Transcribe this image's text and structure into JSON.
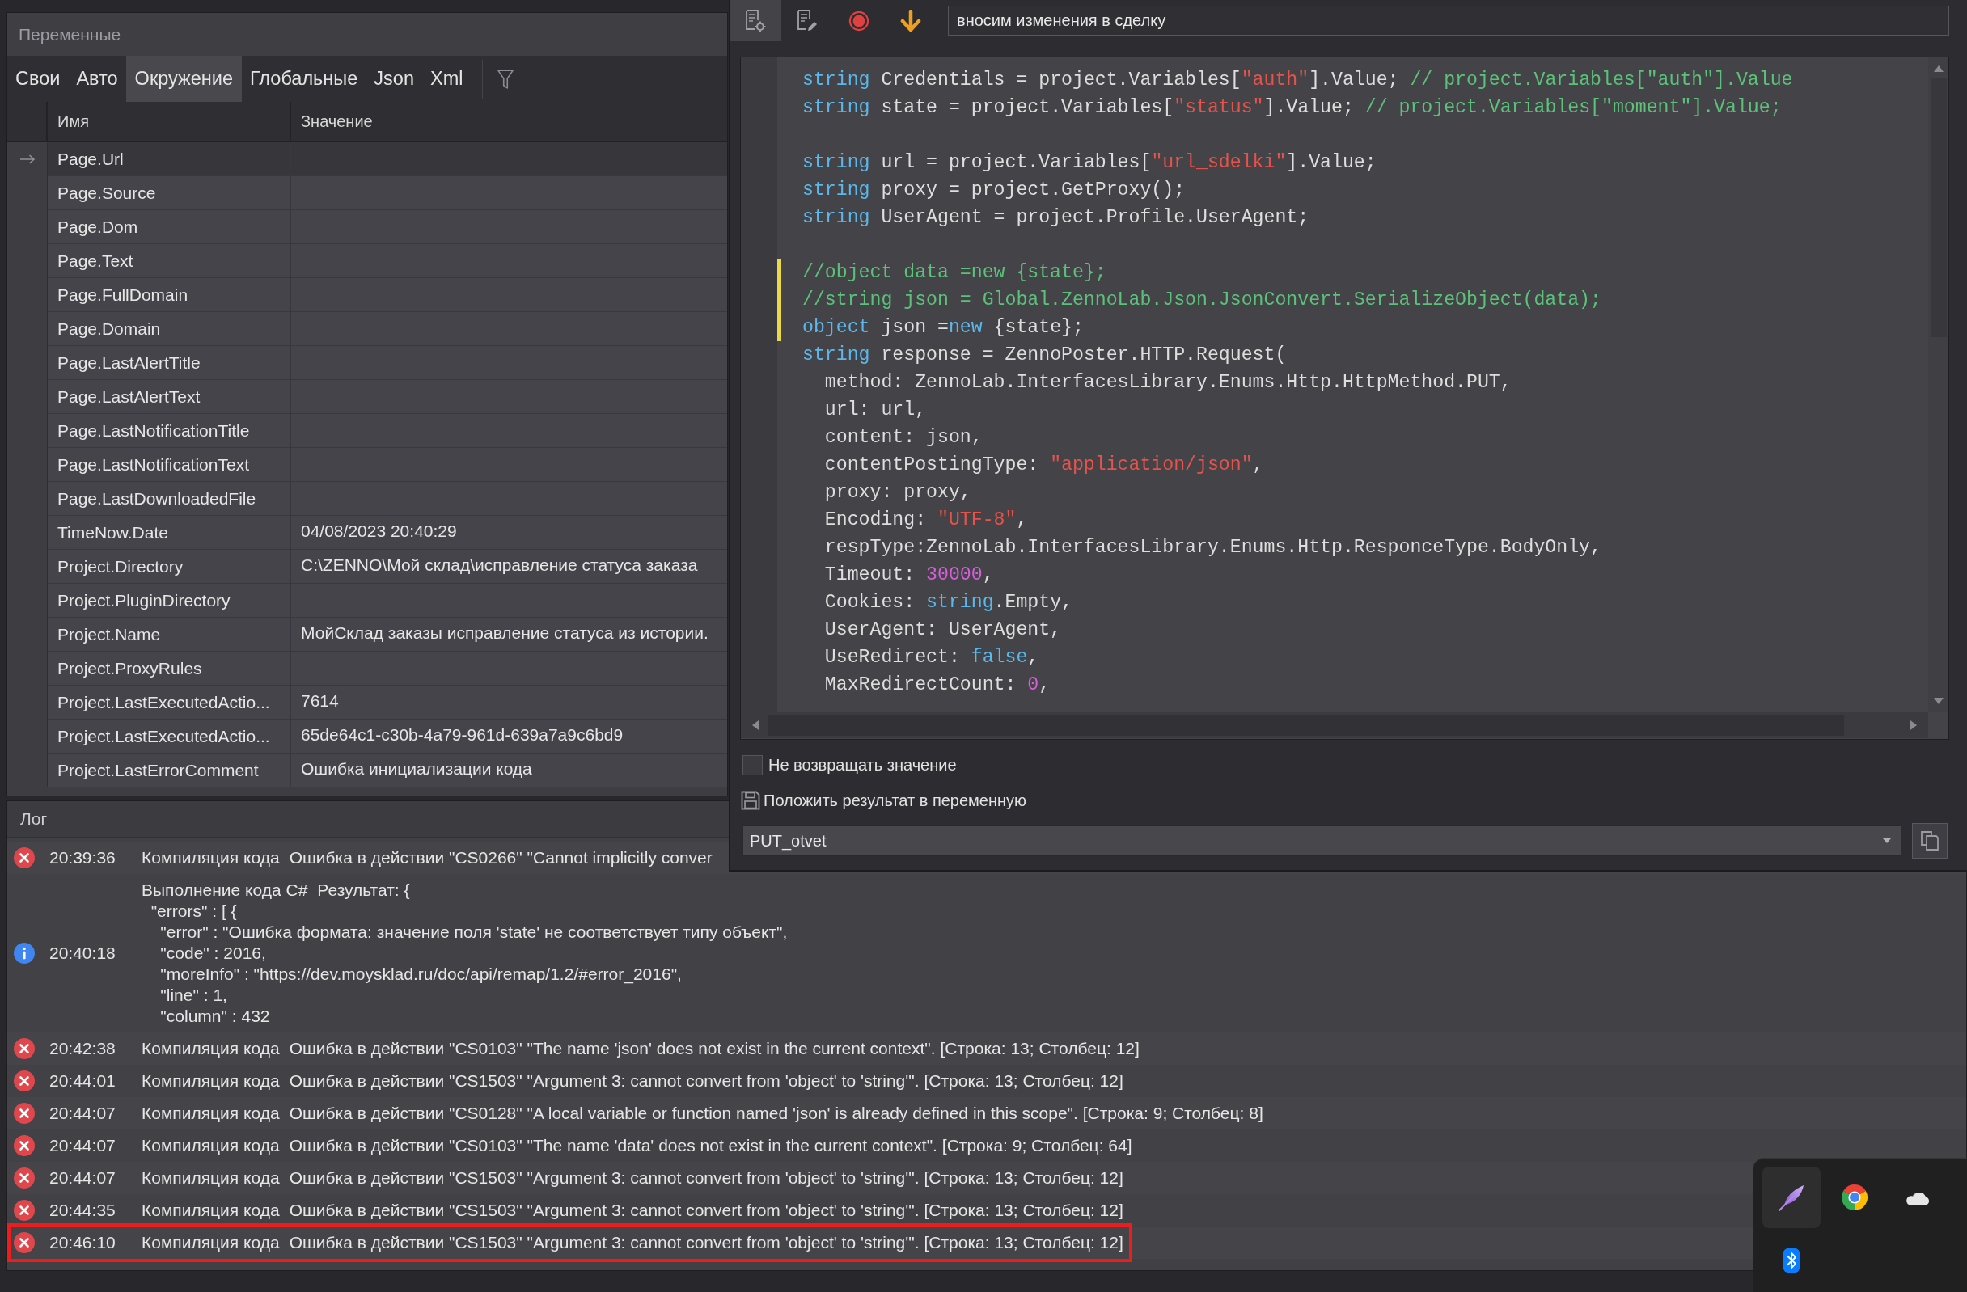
{
  "variables_panel": {
    "title": "Переменные",
    "tabs": [
      {
        "label": "Свои",
        "selected": false
      },
      {
        "label": "Авто",
        "selected": false
      },
      {
        "label": "Окружение",
        "selected": true
      },
      {
        "label": "Глобальные",
        "selected": false
      },
      {
        "label": "Json",
        "selected": false
      },
      {
        "label": "Xml",
        "selected": false
      }
    ],
    "columns": [
      "Имя",
      "Значение"
    ],
    "rows": [
      {
        "name": "Page.Url",
        "selected": true
      },
      {
        "name": "Page.Source",
        "selected": false
      },
      {
        "name": "Page.Dom",
        "selected": false
      },
      {
        "name": "Page.Text",
        "selected": false
      },
      {
        "name": "Page.FullDomain",
        "selected": false
      },
      {
        "name": "Page.Domain",
        "selected": false
      },
      {
        "name": "Page.LastAlertTitle",
        "selected": false
      },
      {
        "name": "Page.LastAlertText",
        "selected": false
      },
      {
        "name": "Page.LastNotificationTitle",
        "selected": false
      },
      {
        "name": "Page.LastNotificationText",
        "selected": false
      },
      {
        "name": "Page.LastDownloadedFile",
        "selected": false
      },
      {
        "name": "TimeNow.Date",
        "value": "04/08/2023 20:40:29",
        "selected": false
      },
      {
        "name": "Project.Directory",
        "value": "C:\\ZENNO\\Мой склад\\исправление статуса заказа",
        "selected": false
      },
      {
        "name": "Project.PluginDirectory",
        "selected": false
      },
      {
        "name": "Project.Name",
        "value": "МойСклад заказы исправление статуса из истории.",
        "selected": false
      },
      {
        "name": "Project.ProxyRules",
        "selected": false
      },
      {
        "name": "Project.LastExecutedActio...",
        "value": "7614",
        "selected": false
      },
      {
        "name": "Project.LastExecutedActio...",
        "value": "65de64c1-c30b-4a79-961d-639a7a9c6bd9",
        "selected": false
      },
      {
        "name": "Project.LastErrorComment",
        "value": "Ошибка инициализации кода",
        "selected": false
      }
    ]
  },
  "code_window": {
    "toolbar": {
      "buttons": [
        {
          "kind": "settings",
          "selected": true
        },
        {
          "kind": "edit",
          "selected": false
        },
        {
          "kind": "record",
          "selected": false
        },
        {
          "kind": "down",
          "selected": false
        }
      ],
      "action_name": "вносим изменения в сделку"
    },
    "code_lines": [
      {
        "modified": false,
        "tokens": [
          {
            "kind": "keyword",
            "text": "string"
          },
          {
            "kind": "plain",
            "text": " Credentials = project.Variables["
          },
          {
            "kind": "string",
            "text": "\"auth\""
          },
          {
            "kind": "plain",
            "text": "].Value; "
          },
          {
            "kind": "comment",
            "text": "// project.Variables[\"auth\"].Value"
          }
        ]
      },
      {
        "modified": false,
        "tokens": [
          {
            "kind": "keyword",
            "text": "string"
          },
          {
            "kind": "plain",
            "text": " state = project.Variables["
          },
          {
            "kind": "string",
            "text": "\"status\""
          },
          {
            "kind": "plain",
            "text": "].Value; "
          },
          {
            "kind": "comment",
            "text": "// project.Variables[\"moment\"].Value;"
          }
        ]
      },
      {
        "modified": false
      },
      {
        "modified": false,
        "tokens": [
          {
            "kind": "keyword",
            "text": "string"
          },
          {
            "kind": "plain",
            "text": " url = project.Variables["
          },
          {
            "kind": "string",
            "text": "\"url_sdelki\""
          },
          {
            "kind": "plain",
            "text": "].Value;"
          }
        ]
      },
      {
        "modified": false,
        "tokens": [
          {
            "kind": "keyword",
            "text": "string"
          },
          {
            "kind": "plain",
            "text": " proxy = project.GetProxy();"
          }
        ]
      },
      {
        "modified": false,
        "tokens": [
          {
            "kind": "keyword",
            "text": "string"
          },
          {
            "kind": "plain",
            "text": " UserAgent = project.Profile.UserAgent;"
          }
        ]
      },
      {
        "modified": false
      },
      {
        "modified": true,
        "tokens": [
          {
            "kind": "comment",
            "text": "//object data =new {state};"
          }
        ]
      },
      {
        "modified": true,
        "tokens": [
          {
            "kind": "comment",
            "text": "//string json = Global.ZennoLab.Json.JsonConvert.SerializeObject(data);"
          }
        ]
      },
      {
        "modified": true,
        "tokens": [
          {
            "kind": "keyword",
            "text": "object"
          },
          {
            "kind": "plain",
            "text": " json ="
          },
          {
            "kind": "keyword",
            "text": "new"
          },
          {
            "kind": "plain",
            "text": " {state};"
          }
        ]
      },
      {
        "modified": false,
        "tokens": [
          {
            "kind": "keyword",
            "text": "string"
          },
          {
            "kind": "plain",
            "text": " response = ZennoPoster.HTTP.Request("
          }
        ]
      },
      {
        "modified": false,
        "tokens": [
          {
            "kind": "plain",
            "text": "  method: ZennoLab.InterfacesLibrary.Enums.Http.HttpMethod.PUT,"
          }
        ]
      },
      {
        "modified": false,
        "tokens": [
          {
            "kind": "plain",
            "text": "  url: url,"
          }
        ]
      },
      {
        "modified": false,
        "tokens": [
          {
            "kind": "plain",
            "text": "  content: json,"
          }
        ]
      },
      {
        "modified": false,
        "tokens": [
          {
            "kind": "plain",
            "text": "  contentPostingType: "
          },
          {
            "kind": "string",
            "text": "\"application/json\""
          },
          {
            "kind": "plain",
            "text": ","
          }
        ]
      },
      {
        "modified": false,
        "tokens": [
          {
            "kind": "plain",
            "text": "  proxy: proxy,"
          }
        ]
      },
      {
        "modified": false,
        "tokens": [
          {
            "kind": "plain",
            "text": "  Encoding: "
          },
          {
            "kind": "string",
            "text": "\"UTF-8\""
          },
          {
            "kind": "plain",
            "text": ","
          }
        ]
      },
      {
        "modified": false,
        "tokens": [
          {
            "kind": "plain",
            "text": "  respType:ZennoLab.InterfacesLibrary.Enums.Http.ResponceType.BodyOnly,"
          }
        ]
      },
      {
        "modified": false,
        "tokens": [
          {
            "kind": "plain",
            "text": "  Timeout: "
          },
          {
            "kind": "number",
            "text": "30000"
          },
          {
            "kind": "plain",
            "text": ","
          }
        ]
      },
      {
        "modified": false,
        "tokens": [
          {
            "kind": "plain",
            "text": "  Cookies: "
          },
          {
            "kind": "keyword",
            "text": "string"
          },
          {
            "kind": "plain",
            "text": ".Empty,"
          }
        ]
      },
      {
        "modified": false,
        "tokens": [
          {
            "kind": "plain",
            "text": "  UserAgent: UserAgent,"
          }
        ]
      },
      {
        "modified": false,
        "tokens": [
          {
            "kind": "plain",
            "text": "  UseRedirect: "
          },
          {
            "kind": "keyword",
            "text": "false"
          },
          {
            "kind": "plain",
            "text": ","
          }
        ]
      },
      {
        "modified": false,
        "tokens": [
          {
            "kind": "plain",
            "text": "  MaxRedirectCount: "
          },
          {
            "kind": "number",
            "text": "0"
          },
          {
            "kind": "plain",
            "text": ","
          }
        ]
      }
    ],
    "no_return": {
      "label": "Не возвращать значение",
      "checked": false
    },
    "result": {
      "label": "Положить результат в переменную",
      "variable": "PUT_otvet"
    }
  },
  "log": {
    "title": "Лог",
    "entries": [
      {
        "kind": "error",
        "time": "20:39:36",
        "source": "Компиляция кода",
        "message": "Ошибка в действии \"CS0266\" \"Cannot implicitly conver",
        "highlighted": false
      },
      {
        "kind": "info",
        "time": "20:40:18",
        "source": "Выполнение кода C#",
        "message": "Результат: {",
        "details": [
          "  \"errors\" : [ {",
          "    \"error\" : \"Ошибка формата: значение поля 'state' не соответствует типу объект\",",
          "    \"code\" : 2016,",
          "    \"moreInfo\" : \"https://dev.moysklad.ru/doc/api/remap/1.2/#error_2016\",",
          "    \"line\" : 1,",
          "    \"column\" : 432"
        ],
        "highlighted": false
      },
      {
        "kind": "error",
        "time": "20:42:38",
        "source": "Компиляция кода",
        "message": "Ошибка в действии \"CS0103\" \"The name 'json' does not exist in the current context\". [Строка: 13; Столбец: 12]",
        "highlighted": false
      },
      {
        "kind": "error",
        "time": "20:44:01",
        "source": "Компиляция кода",
        "message": "Ошибка в действии \"CS1503\" \"Argument 3: cannot convert from 'object' to 'string'\". [Строка: 13; Столбец: 12]",
        "highlighted": false
      },
      {
        "kind": "error",
        "time": "20:44:07",
        "source": "Компиляция кода",
        "message": "Ошибка в действии \"CS0128\" \"A local variable or function named 'json' is already defined in this scope\". [Строка: 9; Столбец: 8]",
        "highlighted": false
      },
      {
        "kind": "error",
        "time": "20:44:07",
        "source": "Компиляция кода",
        "message": "Ошибка в действии \"CS0103\" \"The name 'data' does not exist in the current context\". [Строка: 9; Столбец: 64]",
        "highlighted": false
      },
      {
        "kind": "error",
        "time": "20:44:07",
        "source": "Компиляция кода",
        "message": "Ошибка в действии \"CS1503\" \"Argument 3: cannot convert from 'object' to 'string'\". [Строка: 13; Столбец: 12]",
        "highlighted": false
      },
      {
        "kind": "error",
        "time": "20:44:35",
        "source": "Компиляция кода",
        "message": "Ошибка в действии \"CS1503\" \"Argument 3: cannot convert from 'object' to 'string'\". [Строка: 13; Столбец: 12]",
        "highlighted": false
      },
      {
        "kind": "error",
        "time": "20:46:10",
        "source": "Компиляция кода",
        "message": "Ошибка в действии \"CS1503\" \"Argument 3: cannot convert from 'object' to 'string'\". [Строка: 13; Столбец: 12]",
        "highlighted": true
      }
    ]
  },
  "tray": {
    "icons": [
      {
        "kind": "feather",
        "hovered": true
      },
      {
        "kind": "browser",
        "hovered": false
      },
      {
        "kind": "cloud",
        "hovered": false
      },
      {
        "kind": "bluetooth",
        "hovered": false
      }
    ]
  }
}
